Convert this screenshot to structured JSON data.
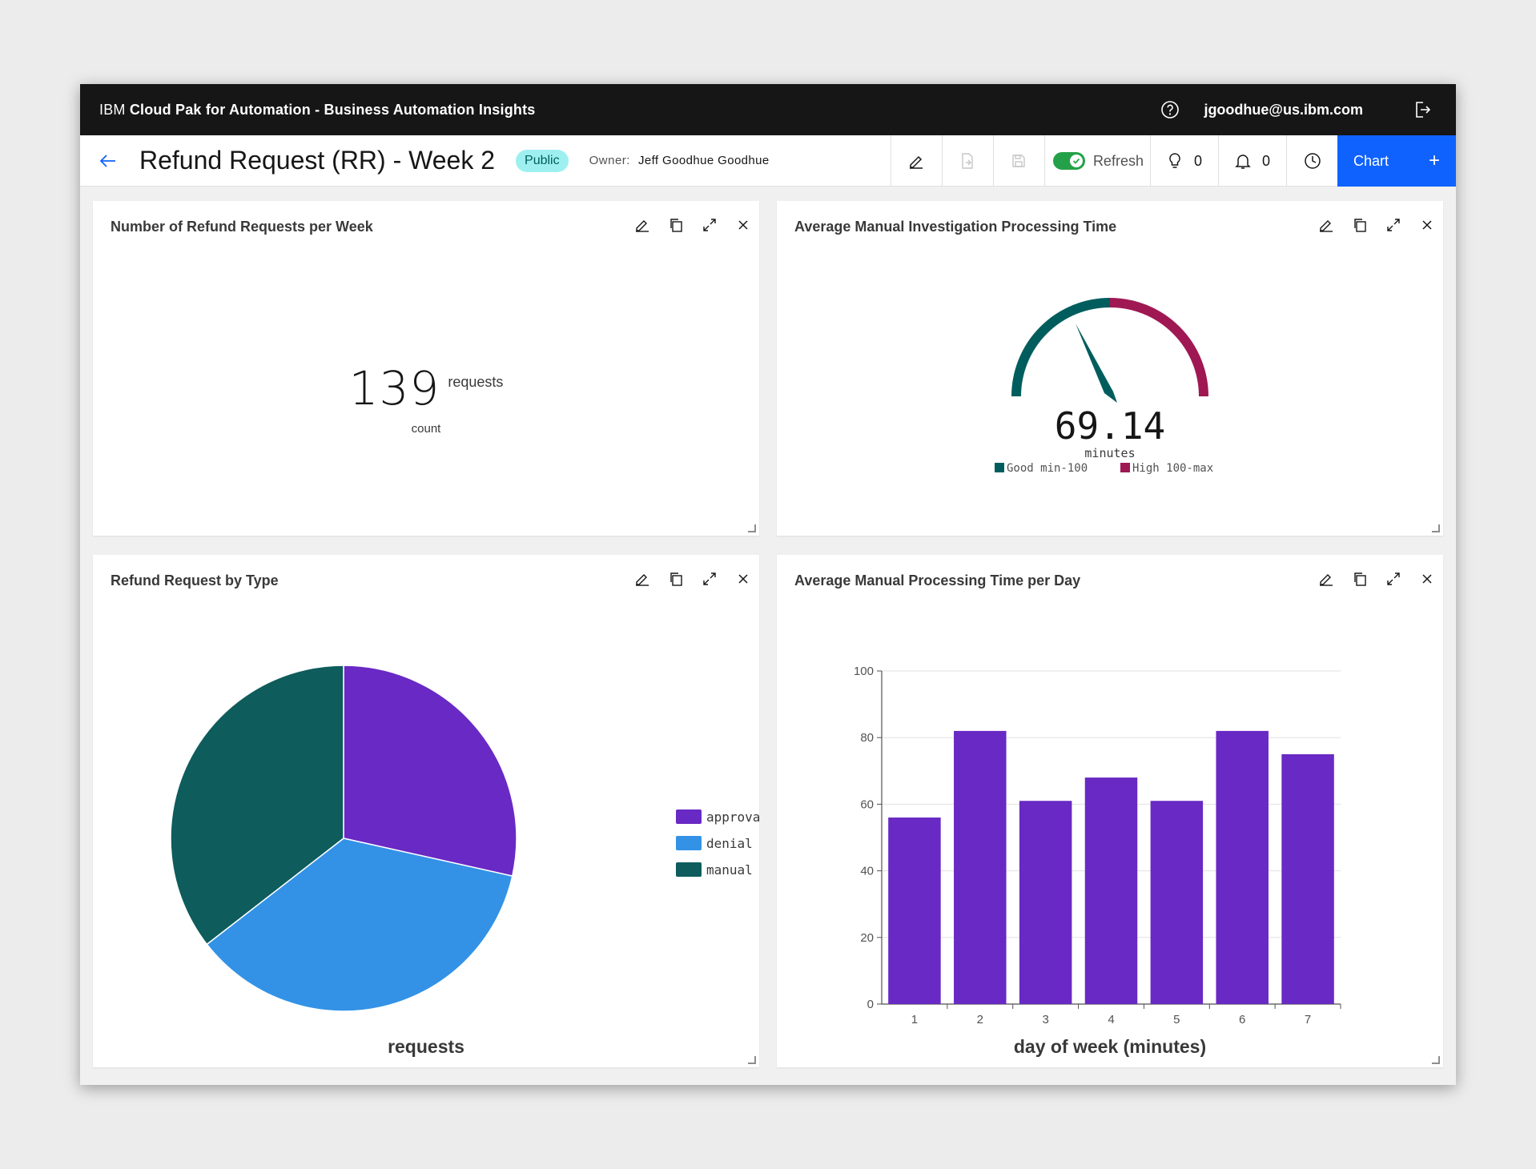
{
  "app": {
    "brand_ibm": "IBM",
    "brand_product": "Cloud Pak for Automation - Business Automation Insights",
    "user_email": "jgoodhue@us.ibm.com"
  },
  "header": {
    "title": "Refund Request (RR) - Week 2",
    "badge": "Public",
    "owner_label": "Owner:",
    "owner_name": "Jeff Goodhue Goodhue",
    "refresh_label": "Refresh",
    "refresh_on": true,
    "ideas_count": "0",
    "alerts_count": "0",
    "chart_button": "Chart",
    "chart_plus": "+"
  },
  "widgets": {
    "kpi": {
      "title": "Number of Refund Requests per Week",
      "value": "139",
      "unit": "requests",
      "sub": "count"
    },
    "gauge": {
      "title": "Average Manual Investigation Processing Time",
      "value": "69.14",
      "unit": "minutes",
      "legend_good": "Good min-100",
      "legend_high": "High 100-max",
      "good_color": "#005d5d",
      "high_color": "#9f1853"
    },
    "pie": {
      "title": "Refund Request by Type",
      "xlabel": "requests"
    },
    "bar": {
      "title": "Average Manual Processing Time per Day",
      "xlabel": "day of week (minutes)"
    }
  },
  "chart_data": [
    {
      "type": "pie",
      "categories": [
        "approva",
        "denial",
        "manual"
      ],
      "values": [
        28.5,
        36,
        35.5
      ],
      "colors": [
        "#6929c4",
        "#3392e6",
        "#0e5c5c"
      ],
      "xlabel": "requests",
      "legend": "right"
    },
    {
      "type": "bar",
      "categories": [
        "1",
        "2",
        "3",
        "4",
        "5",
        "6",
        "7"
      ],
      "values": [
        56,
        82,
        61,
        68,
        61,
        82,
        75
      ],
      "xlabel": "day of week (minutes)",
      "ylabel": "",
      "ylim": [
        0,
        100
      ],
      "yticks": [
        0,
        20,
        40,
        60,
        80,
        100
      ],
      "color": "#6929c4",
      "grid": true
    }
  ]
}
